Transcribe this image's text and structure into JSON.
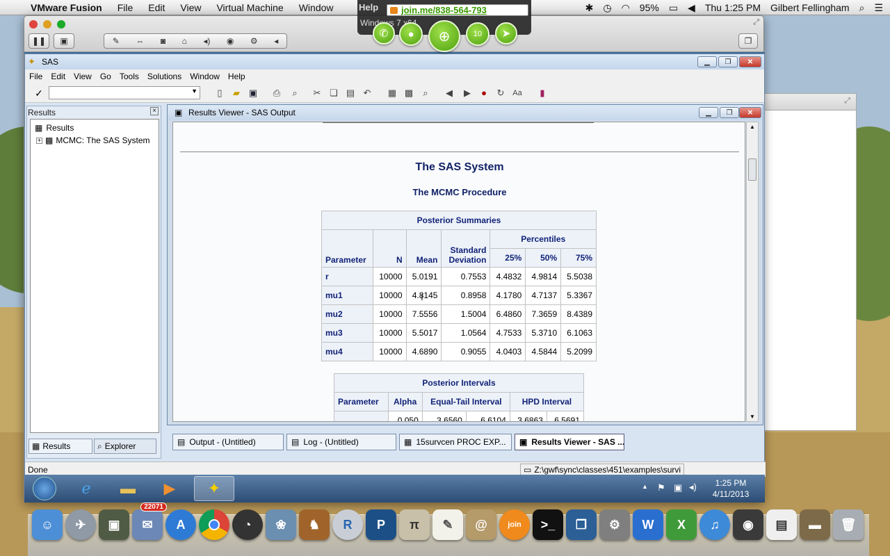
{
  "mac_menubar": {
    "app": "VMware Fusion",
    "menus": [
      "File",
      "Edit",
      "View",
      "Virtual Machine",
      "Window"
    ],
    "battery": "95%",
    "clock": "Thu 1:25 PM",
    "user": "Gilbert Fellingham"
  },
  "joinme": {
    "url": "join.me/838-564-793",
    "help_label": "Help",
    "win_label": "Windows 7 x64",
    "participants": "10"
  },
  "sas": {
    "title": "SAS",
    "menu": [
      "File",
      "Edit",
      "View",
      "Go",
      "Tools",
      "Solutions",
      "Window",
      "Help"
    ],
    "status_left": "Done",
    "status_path": "Z:\\gwf\\sync\\classes\\451\\examples\\survi"
  },
  "results_pane": {
    "header": "Results",
    "tree_root": "Results",
    "tree_child": "MCMC:  The SAS System",
    "tab_results": "Results",
    "tab_explorer": "Explorer"
  },
  "viewer": {
    "title": "Results Viewer - SAS Output",
    "doc_title": "The SAS System",
    "proc_title": "The MCMC Procedure",
    "summaries": {
      "caption": "Posterior Summaries",
      "percentiles_header": "Percentiles",
      "columns": [
        "Parameter",
        "N",
        "Mean",
        "Standard Deviation",
        "25%",
        "50%",
        "75%"
      ],
      "rows": [
        [
          "r",
          "10000",
          "5.0191",
          "0.7553",
          "4.4832",
          "4.9814",
          "5.5038"
        ],
        [
          "mu1",
          "10000",
          "4.8145",
          "0.8958",
          "4.1780",
          "4.7137",
          "5.3367"
        ],
        [
          "mu2",
          "10000",
          "7.5556",
          "1.5004",
          "6.4860",
          "7.3659",
          "8.4389"
        ],
        [
          "mu3",
          "10000",
          "5.5017",
          "1.0564",
          "4.7533",
          "5.3710",
          "6.1063"
        ],
        [
          "mu4",
          "10000",
          "4.6890",
          "0.9055",
          "4.0403",
          "4.5844",
          "5.2099"
        ]
      ]
    },
    "intervals": {
      "caption": "Posterior Intervals",
      "columns": [
        "Parameter",
        "Alpha",
        "Equal-Tail Interval",
        "HPD Interval"
      ],
      "partial_row": [
        "",
        "0.050",
        "3.6560",
        "6.6104",
        "3.6863",
        "6.5691"
      ]
    }
  },
  "task_tabs": [
    "Output - (Untitled)",
    "Log - (Untitled)",
    "15survcen      PROC EXP...",
    "Results Viewer - SAS ..."
  ],
  "win_taskbar": {
    "time": "1:25 PM",
    "date": "4/11/2013"
  },
  "dock": {
    "mail_badge": "22071"
  }
}
